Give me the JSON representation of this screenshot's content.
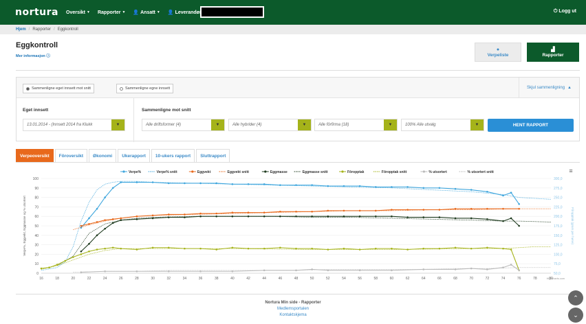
{
  "nav": {
    "logo": "nortura",
    "items": [
      "Oversikt",
      "Rapporter",
      "Ansatt",
      "Leverandør"
    ],
    "logout": "Logg ut"
  },
  "breadcrumb": [
    "Hjem",
    "Rapporter",
    "Eggkontroll"
  ],
  "page": {
    "title": "Eggkontroll",
    "more_info": "Mer informasjon"
  },
  "buttons": {
    "verpeliste": "Verpeliste",
    "rapporter": "Rapporter",
    "hent": "HENT RAPPORT"
  },
  "compare": {
    "radio1": "Sammenligne eget innsett mot snitt",
    "radio2": "Sammenligne egne innsett",
    "hide": "Skjul sammenligning",
    "own_label": "Eget innsett",
    "against_label": "Sammenligne mot snitt",
    "own_value": "13.01.2014 - (Innsett 2014 fra Klukk",
    "sel1": "Alle driftsformer (4)",
    "sel2": "Alle hybrider (4)",
    "sel3": "Alle fôrfirma (18)",
    "sel4": "100% Alle utvalg"
  },
  "tabs": [
    "Verpeoversikt",
    "Fôroversikt",
    "Økonomi",
    "Ukerapport",
    "10-ukers rapport",
    "Sluttrapport"
  ],
  "footer": {
    "title": "Nortura Min side - Rapporter",
    "links": [
      "Medlemsportalen",
      "Kontaktskjema"
    ]
  },
  "chart_data": {
    "type": "line",
    "credit": "Highcharts.com",
    "legend": [
      "Verpe%",
      "Verpe% snitt",
      "Eggvekt",
      "Eggvekt snitt",
      "Eggmasse",
      "Eggmasse snitt",
      "Fôropptak",
      "Fôropptak snitt",
      "% utsortert",
      "% utsortert snitt"
    ],
    "colors": {
      "Verpe%": "#3fa6dd",
      "Eggvekt": "#e8691c",
      "Eggmasse": "#1f3b1f",
      "Fôropptak": "#a5b31a",
      "% utsortert": "#bbbbbb"
    },
    "ylabel": "Verpe%, Eggvekt, Eggmasse og % utsortert",
    "y2label": "Fôropptak (gram per høne)",
    "x_ticks": [
      16,
      18,
      20,
      22,
      24,
      26,
      28,
      30,
      32,
      34,
      36,
      38,
      40,
      42,
      44,
      46,
      48,
      50,
      52,
      54,
      56,
      58,
      60,
      62,
      64,
      66,
      68,
      70,
      72,
      74,
      76,
      78,
      80
    ],
    "y_ticks": [
      0,
      10,
      20,
      30,
      40,
      50,
      60,
      70,
      80,
      90,
      100
    ],
    "y2_ticks": [
      "50,0",
      "75,0",
      "100,0",
      "125,0",
      "150,0",
      "175,0",
      "200,0",
      "225,0",
      "250,0",
      "275,0",
      "300,0"
    ],
    "xlim": [
      16,
      80
    ],
    "ylim": [
      0,
      100
    ],
    "series": [
      {
        "name": "Verpe%",
        "dashed": false,
        "x": [
          21,
          22,
          23,
          24,
          25,
          26,
          28,
          30,
          32,
          34,
          36,
          38,
          40,
          42,
          44,
          46,
          48,
          50,
          52,
          54,
          56,
          58,
          60,
          62,
          64,
          66,
          68,
          70,
          72,
          74,
          75,
          76
        ],
        "values": [
          48,
          58,
          68,
          80,
          90,
          96,
          96,
          96,
          95,
          95,
          95,
          95,
          94,
          94,
          94,
          93,
          93,
          93,
          92,
          92,
          92,
          91,
          91,
          91,
          90,
          90,
          89,
          88,
          86,
          82,
          85,
          73
        ]
      },
      {
        "name": "Verpe% snitt",
        "dashed": true,
        "x": [
          16,
          18,
          19,
          20,
          21,
          22,
          23,
          24,
          25,
          26,
          28,
          30,
          35,
          40,
          45,
          50,
          55,
          60,
          65,
          70,
          74,
          76,
          78,
          80
        ],
        "values": [
          3,
          6,
          12,
          28,
          55,
          75,
          88,
          94,
          96,
          97,
          97,
          96,
          95,
          94,
          93,
          92,
          91,
          90,
          88,
          86,
          83,
          80,
          79,
          78
        ]
      },
      {
        "name": "Eggvekt",
        "dashed": false,
        "x": [
          21,
          22,
          23,
          24,
          25,
          26,
          28,
          30,
          32,
          34,
          36,
          38,
          40,
          42,
          44,
          46,
          48,
          50,
          52,
          54,
          56,
          58,
          60,
          62,
          64,
          66,
          68,
          70,
          72,
          74,
          76
        ],
        "values": [
          50,
          52,
          54,
          56,
          57,
          58,
          60,
          61,
          62,
          62,
          63,
          63,
          64,
          64,
          64,
          65,
          65,
          65,
          66,
          66,
          66,
          66,
          67,
          67,
          67,
          67,
          68,
          68,
          68,
          68,
          68
        ]
      },
      {
        "name": "Eggvekt snitt",
        "dashed": true,
        "x": [
          20,
          22,
          24,
          26,
          28,
          30,
          35,
          40,
          45,
          50,
          55,
          60,
          65,
          70,
          75,
          80
        ],
        "values": [
          46,
          51,
          55,
          58,
          60,
          61,
          62,
          63,
          64,
          65,
          66,
          66,
          67,
          67,
          68,
          68
        ]
      },
      {
        "name": "Eggmasse",
        "dashed": false,
        "x": [
          21,
          22,
          23,
          24,
          25,
          26,
          28,
          30,
          32,
          34,
          36,
          38,
          40,
          42,
          44,
          46,
          48,
          50,
          52,
          54,
          56,
          58,
          60,
          62,
          64,
          66,
          68,
          70,
          72,
          74,
          75,
          76
        ],
        "values": [
          23,
          31,
          40,
          47,
          53,
          56,
          57,
          58,
          59,
          59,
          60,
          60,
          60,
          60,
          60,
          60,
          60,
          60,
          60,
          60,
          60,
          60,
          60,
          59,
          59,
          59,
          58,
          58,
          57,
          55,
          58,
          50
        ]
      },
      {
        "name": "Eggmasse snitt",
        "dashed": true,
        "x": [
          18,
          20,
          22,
          24,
          26,
          28,
          30,
          35,
          40,
          45,
          50,
          55,
          60,
          65,
          70,
          74,
          76,
          80
        ],
        "values": [
          8,
          18,
          42,
          52,
          56,
          58,
          59,
          60,
          60,
          60,
          59,
          59,
          58,
          57,
          56,
          55,
          55,
          54
        ]
      },
      {
        "name": "Fôropptak",
        "dashed": false,
        "x": [
          16,
          17,
          18,
          19,
          20,
          21,
          22,
          23,
          24,
          25,
          26,
          28,
          30,
          32,
          34,
          36,
          38,
          40,
          42,
          44,
          46,
          48,
          50,
          52,
          54,
          56,
          58,
          60,
          62,
          64,
          66,
          68,
          70,
          72,
          74,
          75,
          76
        ],
        "values": [
          5,
          6,
          9,
          13,
          17,
          20,
          23,
          25,
          26,
          27,
          26,
          25,
          27,
          27,
          26,
          26,
          25,
          27,
          26,
          26,
          27,
          26,
          26,
          25,
          26,
          25,
          26,
          26,
          25,
          26,
          26,
          27,
          26,
          27,
          26,
          25,
          3
        ]
      },
      {
        "name": "Fôropptak snitt",
        "dashed": true,
        "x": [
          16,
          18,
          20,
          22,
          24,
          26,
          28,
          30,
          40,
          50,
          60,
          70,
          74,
          76,
          78,
          80
        ],
        "values": [
          4,
          8,
          14,
          20,
          24,
          26,
          26,
          26,
          26,
          25,
          25,
          26,
          26,
          27,
          28,
          28
        ]
      },
      {
        "name": "% utsortert",
        "dashed": false,
        "x": [
          21,
          24,
          28,
          32,
          36,
          40,
          44,
          48,
          50,
          52,
          56,
          60,
          64,
          68,
          70,
          72,
          74,
          75,
          76
        ],
        "values": [
          1,
          2,
          2,
          2,
          2,
          2,
          3,
          3,
          4,
          3,
          3,
          3,
          4,
          4,
          5,
          4,
          6,
          9,
          3
        ]
      },
      {
        "name": "% utsortert snitt",
        "dashed": true,
        "x": [
          20,
          24,
          28,
          32,
          36,
          40,
          44,
          48,
          52,
          56,
          60,
          64,
          68,
          72,
          76,
          80
        ],
        "values": [
          1,
          2,
          2,
          3,
          3,
          3,
          3,
          3,
          4,
          4,
          4,
          4,
          5,
          5,
          6,
          6
        ]
      }
    ]
  }
}
